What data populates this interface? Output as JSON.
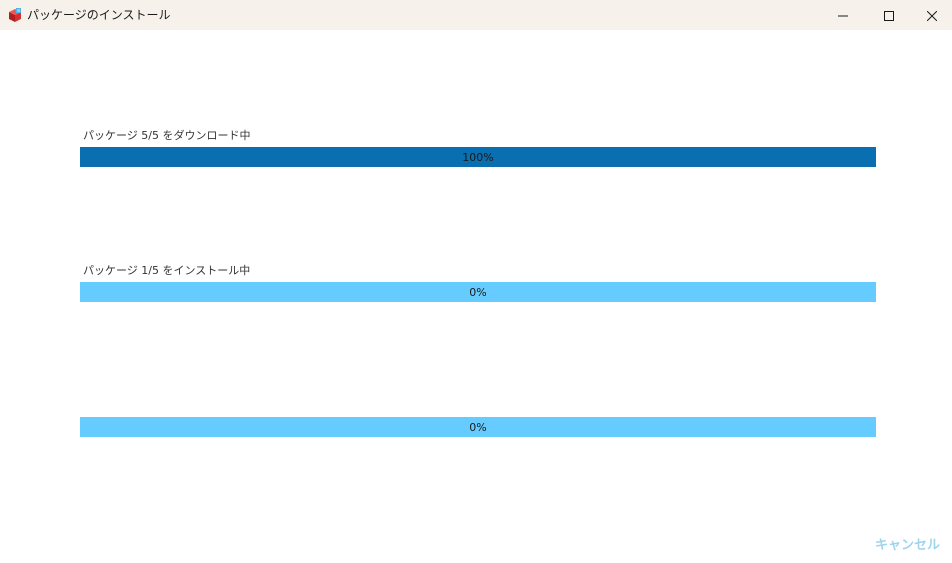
{
  "window": {
    "title": "パッケージのインストール",
    "controls": {
      "minimize": "minimize-icon",
      "maximize": "maximize-icon",
      "close": "close-icon"
    }
  },
  "progress": [
    {
      "label": "パッケージ 5/5 をダウンロード中",
      "percent_text": "100%",
      "value": 1.0
    },
    {
      "label": "パッケージ 1/5 をインストール中",
      "percent_text": "0%",
      "value": 0.0
    },
    {
      "label": "",
      "percent_text": "0%",
      "value": 0.0
    }
  ],
  "footer": {
    "cancel_label": "キャンセル"
  },
  "colors": {
    "titlebar_bg": "#f6f1ea",
    "bar_track": "#66ccff",
    "bar_fill": "#0a6fb0",
    "cancel_text": "#9fd4ef"
  }
}
